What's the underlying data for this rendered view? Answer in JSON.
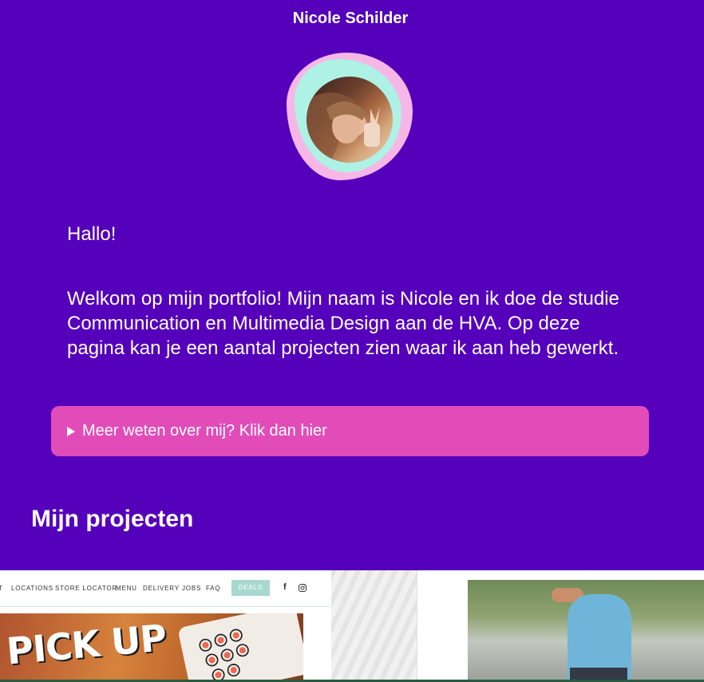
{
  "header": {
    "title": "Nicole Schilder"
  },
  "intro": {
    "greeting": "Hallo!",
    "welcome": "Welkom op mijn portfolio! Mijn naam is Nicole en ik doe de studie Communication en Multimedia Design aan de HVA. Op deze pagina kan je een aantal projecten zien waar ik aan heb gewerkt."
  },
  "details": {
    "summary": "Meer weten over mij? Klik dan hier"
  },
  "projects": {
    "title": "Mijn projecten",
    "project1": {
      "nav_items": [
        "LOCATIONS",
        "STORE LOCATOR",
        "MENU",
        "DELIVERY",
        "JOBS",
        "FAQ"
      ],
      "deals_label": "DEALS",
      "hero_text": "PICK UP"
    }
  },
  "colors": {
    "background": "#5500bb",
    "details_bg": "#e24cb9",
    "blob_pink": "#f6b7e6",
    "blob_mint": "#aef2e6"
  }
}
